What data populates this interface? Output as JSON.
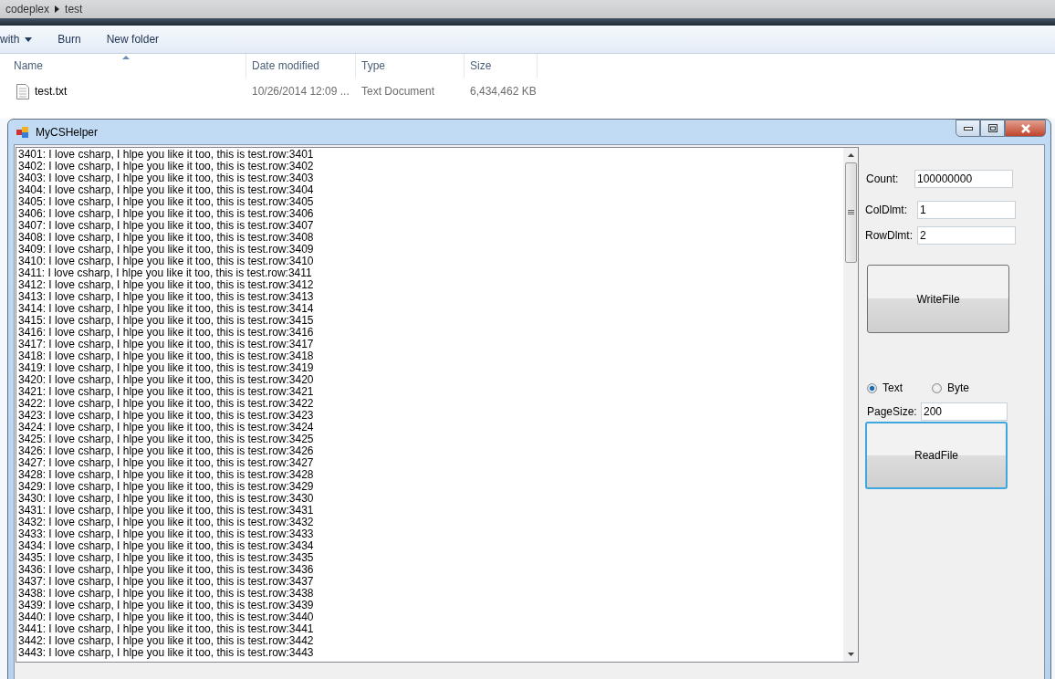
{
  "explorer": {
    "breadcrumb": [
      "codeplex",
      "test"
    ],
    "toolbar": [
      {
        "label": "with",
        "dropdown": true
      },
      {
        "label": "Burn",
        "dropdown": false
      },
      {
        "label": "New folder",
        "dropdown": false
      }
    ],
    "columns": [
      "Name",
      "Date modified",
      "Type",
      "Size"
    ],
    "files": [
      {
        "name": "test.txt",
        "date": "10/26/2014 12:09 ...",
        "type": "Text Document",
        "size": "6,434,462 KB"
      }
    ]
  },
  "window": {
    "title": "MyCSHelper",
    "lines": [
      "3401: I love csharp, I hlpe you like it too, this is test.row:3401",
      "3402: I love csharp, I hlpe you like it too, this is test.row:3402",
      "3403: I love csharp, I hlpe you like it too, this is test.row:3403",
      "3404: I love csharp, I hlpe you like it too, this is test.row:3404",
      "3405: I love csharp, I hlpe you like it too, this is test.row:3405",
      "3406: I love csharp, I hlpe you like it too, this is test.row:3406",
      "3407: I love csharp, I hlpe you like it too, this is test.row:3407",
      "3408: I love csharp, I hlpe you like it too, this is test.row:3408",
      "3409: I love csharp, I hlpe you like it too, this is test.row:3409",
      "3410: I love csharp, I hlpe you like it too, this is test.row:3410",
      "3411: I love csharp, I hlpe you like it too, this is test.row:3411",
      "3412: I love csharp, I hlpe you like it too, this is test.row:3412",
      "3413: I love csharp, I hlpe you like it too, this is test.row:3413",
      "3414: I love csharp, I hlpe you like it too, this is test.row:3414",
      "3415: I love csharp, I hlpe you like it too, this is test.row:3415",
      "3416: I love csharp, I hlpe you like it too, this is test.row:3416",
      "3417: I love csharp, I hlpe you like it too, this is test.row:3417",
      "3418: I love csharp, I hlpe you like it too, this is test.row:3418",
      "3419: I love csharp, I hlpe you like it too, this is test.row:3419",
      "3420: I love csharp, I hlpe you like it too, this is test.row:3420",
      "3421: I love csharp, I hlpe you like it too, this is test.row:3421",
      "3422: I love csharp, I hlpe you like it too, this is test.row:3422",
      "3423: I love csharp, I hlpe you like it too, this is test.row:3423",
      "3424: I love csharp, I hlpe you like it too, this is test.row:3424",
      "3425: I love csharp, I hlpe you like it too, this is test.row:3425",
      "3426: I love csharp, I hlpe you like it too, this is test.row:3426",
      "3427: I love csharp, I hlpe you like it too, this is test.row:3427",
      "3428: I love csharp, I hlpe you like it too, this is test.row:3428",
      "3429: I love csharp, I hlpe you like it too, this is test.row:3429",
      "3430: I love csharp, I hlpe you like it too, this is test.row:3430",
      "3431: I love csharp, I hlpe you like it too, this is test.row:3431",
      "3432: I love csharp, I hlpe you like it too, this is test.row:3432",
      "3433: I love csharp, I hlpe you like it too, this is test.row:3433",
      "3434: I love csharp, I hlpe you like it too, this is test.row:3434",
      "3435: I love csharp, I hlpe you like it too, this is test.row:3435",
      "3436: I love csharp, I hlpe you like it too, this is test.row:3436",
      "3437: I love csharp, I hlpe you like it too, this is test.row:3437",
      "3438: I love csharp, I hlpe you like it too, this is test.row:3438",
      "3439: I love csharp, I hlpe you like it too, this is test.row:3439",
      "3440: I love csharp, I hlpe you like it too, this is test.row:3440",
      "3441: I love csharp, I hlpe you like it too, this is test.row:3441",
      "3442: I love csharp, I hlpe you like it too, this is test.row:3442",
      "3443: I love csharp, I hlpe you like it too, this is test.row:3443"
    ],
    "fields": [
      {
        "label": "Count:",
        "value": "100000000"
      },
      {
        "label": "ColDlmt:",
        "value": "1"
      },
      {
        "label": "RowDlmt:",
        "value": "2"
      }
    ],
    "write_button": "WriteFile",
    "modes": [
      {
        "label": "Text",
        "selected": true
      },
      {
        "label": "Byte",
        "selected": false
      }
    ],
    "page_size": {
      "label": "PageSize:",
      "value": "200"
    },
    "read_button": {
      "label": "ReadFile",
      "focused": true
    }
  }
}
